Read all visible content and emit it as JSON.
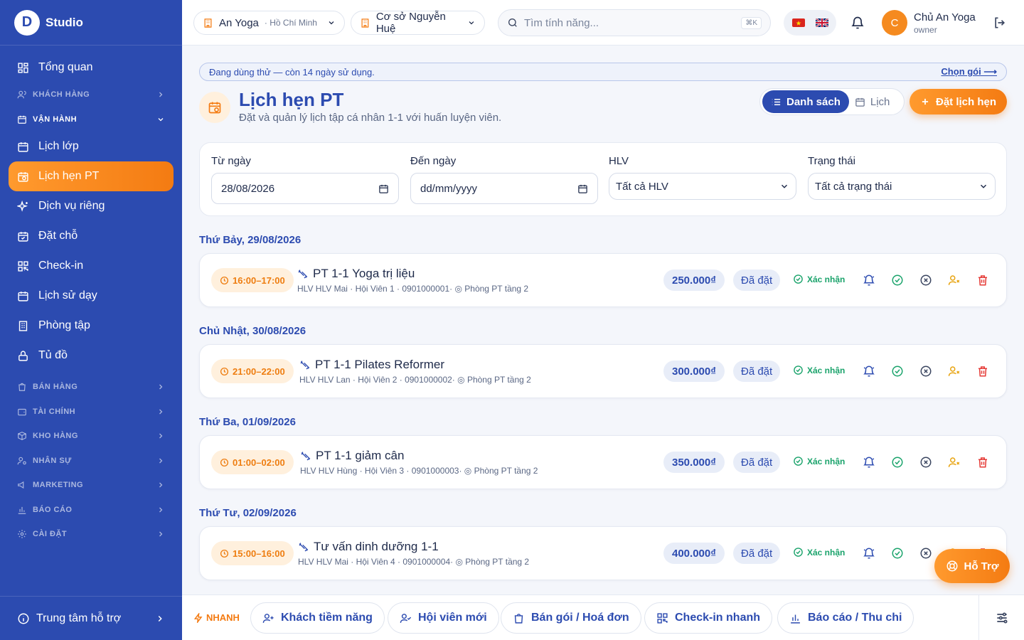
{
  "sidebar": {
    "brand": "Studio",
    "logo_letter": "D",
    "items": [
      {
        "label": "Tổng quan"
      },
      {
        "label": "Lịch lớp"
      },
      {
        "label": "Lịch hẹn PT"
      },
      {
        "label": "Dịch vụ riêng"
      },
      {
        "label": "Đặt chỗ"
      },
      {
        "label": "Check-in"
      },
      {
        "label": "Lịch sử dạy"
      },
      {
        "label": "Phòng tập"
      },
      {
        "label": "Tủ đồ"
      }
    ],
    "groups": {
      "customers": "KHÁCH HÀNG",
      "operations": "VẬN HÀNH",
      "sales": "BÁN HÀNG",
      "finance": "TÀI CHÍNH",
      "warehouse": "KHO HÀNG",
      "hr": "NHÂN SỰ",
      "marketing": "MARKETING",
      "reports": "BÁO CÁO",
      "settings": "CÀI ĐẶT"
    },
    "support": "Trung tâm hỗ trợ"
  },
  "header": {
    "studio_name": "An Yoga",
    "studio_city": "· Hồ Chí Minh",
    "branch": "Cơ sở Nguyễn Huệ",
    "search_placeholder": "Tìm tính năng...",
    "search_shortcut": "⌘K",
    "user_initial": "C",
    "user_name": "Chủ An Yoga",
    "user_role": "owner"
  },
  "trial": {
    "text": "Đang dùng thử — còn 14 ngày sử dụng.",
    "link": "Chọn gói ⟶"
  },
  "page": {
    "title": "Lịch hẹn PT",
    "subtitle": "Đặt và quản lý lịch tập cá nhân 1-1 với huấn luyện viên.",
    "view_list": "Danh sách",
    "view_calendar": "Lịch",
    "new_button": "Đặt lịch hẹn"
  },
  "filters": {
    "from_label": "Từ ngày",
    "from_value": "28/08/2026",
    "to_label": "Đến ngày",
    "to_value": "dd/mm/yyyy",
    "coach_label": "HLV",
    "coach_value": "Tất cả HLV",
    "status_label": "Trạng thái",
    "status_value": "Tất cả trạng thái"
  },
  "days": [
    {
      "heading": "Thứ Bảy, 29/08/2026",
      "appointments": [
        {
          "time": "16:00–17:00",
          "title": "PT 1-1 Yoga trị liệu",
          "meta": "HLV HLV Mai · Hội Viên 1 · 0901000001· ◎ Phòng PT tầng 2",
          "price": "250.000₫",
          "status": "Đã đặt",
          "confirm": "Xác nhận"
        }
      ]
    },
    {
      "heading": "Chủ Nhật, 30/08/2026",
      "appointments": [
        {
          "time": "21:00–22:00",
          "title": "PT 1-1 Pilates Reformer",
          "meta": "HLV HLV Lan · Hội Viên 2 · 0901000002· ◎ Phòng PT tầng 2",
          "price": "300.000₫",
          "status": "Đã đặt",
          "confirm": "Xác nhận"
        }
      ]
    },
    {
      "heading": "Thứ Ba, 01/09/2026",
      "appointments": [
        {
          "time": "01:00–02:00",
          "title": "PT 1-1 giảm cân",
          "meta": "HLV HLV Hùng · Hội Viên 3 · 0901000003· ◎ Phòng PT tầng 2",
          "price": "350.000₫",
          "status": "Đã đặt",
          "confirm": "Xác nhận"
        }
      ]
    },
    {
      "heading": "Thứ Tư, 02/09/2026",
      "appointments": [
        {
          "time": "15:00–16:00",
          "title": "Tư vấn dinh dưỡng 1-1",
          "meta": "HLV HLV Mai · Hội Viên 4 · 0901000004· ◎ Phòng PT tầng 2",
          "price": "400.000₫",
          "status": "Đã đặt",
          "confirm": "Xác nhận"
        }
      ]
    }
  ],
  "fab": {
    "label": "Hỗ Trợ"
  },
  "quick": {
    "label": "NHANH",
    "buttons": [
      "Khách tiềm năng",
      "Hội viên mới",
      "Bán gói / Hoá đơn",
      "Check-in nhanh",
      "Báo cáo / Thu chi"
    ]
  },
  "colors": {
    "primary": "#2c4bb0",
    "accent": "#f47b12",
    "success": "#1aa36b",
    "danger": "#e53935"
  }
}
